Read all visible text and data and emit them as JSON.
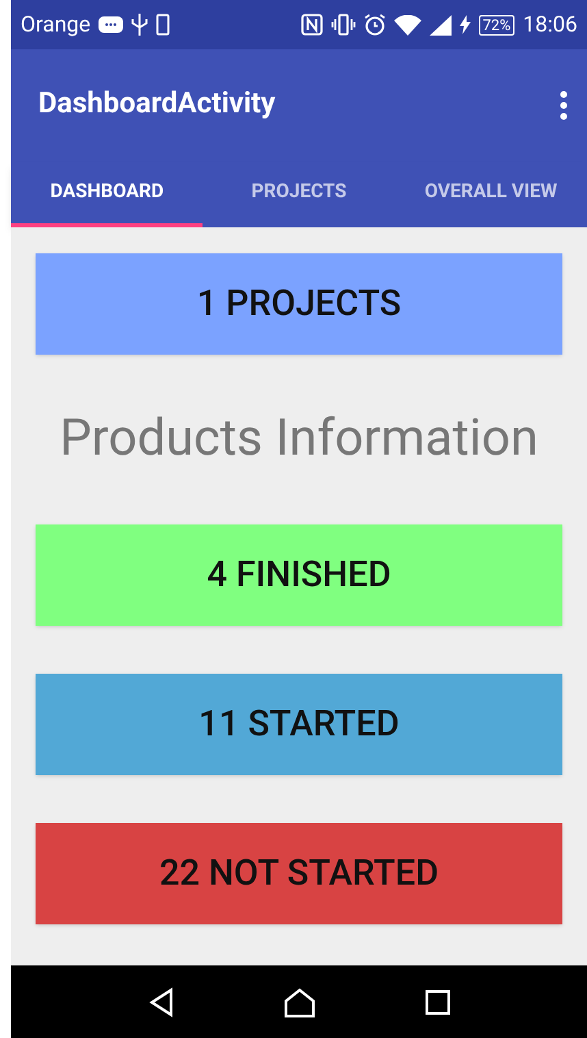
{
  "status_bar": {
    "carrier": "Orange",
    "battery": "72%",
    "time": "18:06"
  },
  "app_bar": {
    "title": "DashboardActivity"
  },
  "tabs": [
    {
      "label": "DASHBOARD",
      "selected": true
    },
    {
      "label": "PROJECTS",
      "selected": false
    },
    {
      "label": "OVERALL VIEW",
      "selected": false
    }
  ],
  "top_cards": [
    {
      "label": "1 PROJECTS",
      "color": "#7ba2ff"
    }
  ],
  "heading": "Products Information",
  "status_cards": [
    {
      "label": "4 FINISHED",
      "color": "#80ff80"
    },
    {
      "label": "11 STARTED",
      "color": "#52a8d6"
    },
    {
      "label": "22 NOT STARTED",
      "color": "#d84343"
    }
  ]
}
